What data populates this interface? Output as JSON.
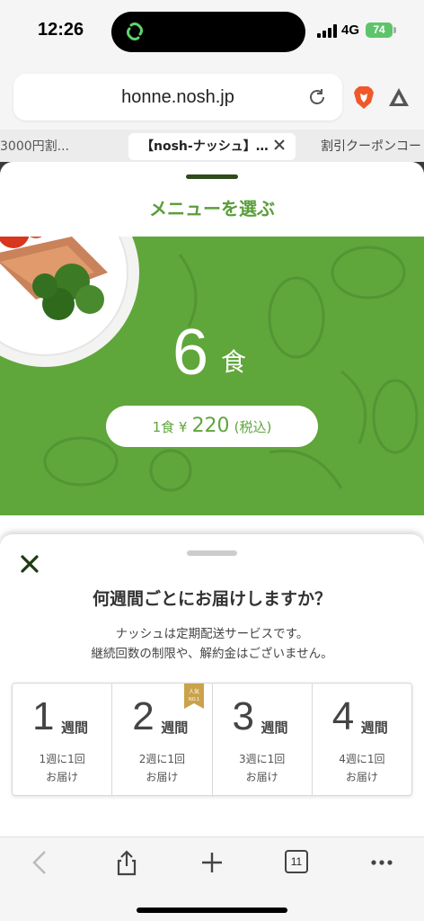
{
  "status": {
    "time": "12:26",
    "network": "4G",
    "battery": "74"
  },
  "browser": {
    "url": "honne.nosh.jp",
    "tabs": {
      "left": "3000円割...",
      "active": "【nosh-ナッシュ】…",
      "right": "割引クーポンコー"
    },
    "tab_count": "11",
    "icons": [
      "reload-icon",
      "brave-icon",
      "triangle-icon",
      "back-icon",
      "share-icon",
      "plus-icon",
      "tabs-icon",
      "more-icon"
    ]
  },
  "page": {
    "menu_title": "メニューを選ぶ",
    "meal_count": "6",
    "meal_unit": "食",
    "price": {
      "prefix": "1食 ¥",
      "amount": "220",
      "suffix": "(税込)"
    }
  },
  "sheet": {
    "title": "何週間ごとにお届けしますか？",
    "desc_line1": "ナッシュは定期配送サービスです。",
    "desc_line2": "継続回数の制限や、解約金はございません。",
    "options": [
      {
        "num": "1",
        "unit": "週間",
        "desc1": "1週に1回",
        "desc2": "お届け"
      },
      {
        "num": "2",
        "unit": "週間",
        "desc1": "2週に1回",
        "desc2": "お届け"
      },
      {
        "num": "3",
        "unit": "週間",
        "desc1": "3週に1回",
        "desc2": "お届け"
      },
      {
        "num": "4",
        "unit": "週間",
        "desc1": "4週に1回",
        "desc2": "お届け"
      }
    ],
    "badge": {
      "line1": "人気",
      "line2": "NO.1"
    }
  },
  "colors": {
    "brand_green": "#5fa63b",
    "title_green": "#5a9e3c",
    "battery_green": "#5ec46a"
  }
}
